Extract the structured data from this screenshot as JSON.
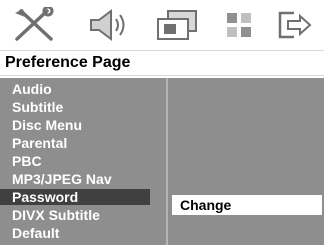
{
  "icons": [
    {
      "name": "general-setup-icon"
    },
    {
      "name": "audio-setup-icon"
    },
    {
      "name": "video-setup-icon"
    },
    {
      "name": "preference-setup-icon"
    },
    {
      "name": "exit-icon"
    }
  ],
  "page": {
    "title": "Preference Page"
  },
  "menu": {
    "items": [
      {
        "label": "Audio"
      },
      {
        "label": "Subtitle"
      },
      {
        "label": "Disc Menu"
      },
      {
        "label": "Parental"
      },
      {
        "label": "PBC"
      },
      {
        "label": "MP3/JPEG Nav"
      },
      {
        "label": "Password",
        "active": true
      },
      {
        "label": "DIVX Subtitle"
      },
      {
        "label": "Default"
      }
    ],
    "options": [
      {
        "label": "Change",
        "selected": true
      }
    ]
  },
  "colors": {
    "menu_bg": "#8e8e8e",
    "highlight": "#404040",
    "option_highlight": "#ffffff",
    "text_light": "#ffffff",
    "text_dark": "#000000"
  }
}
